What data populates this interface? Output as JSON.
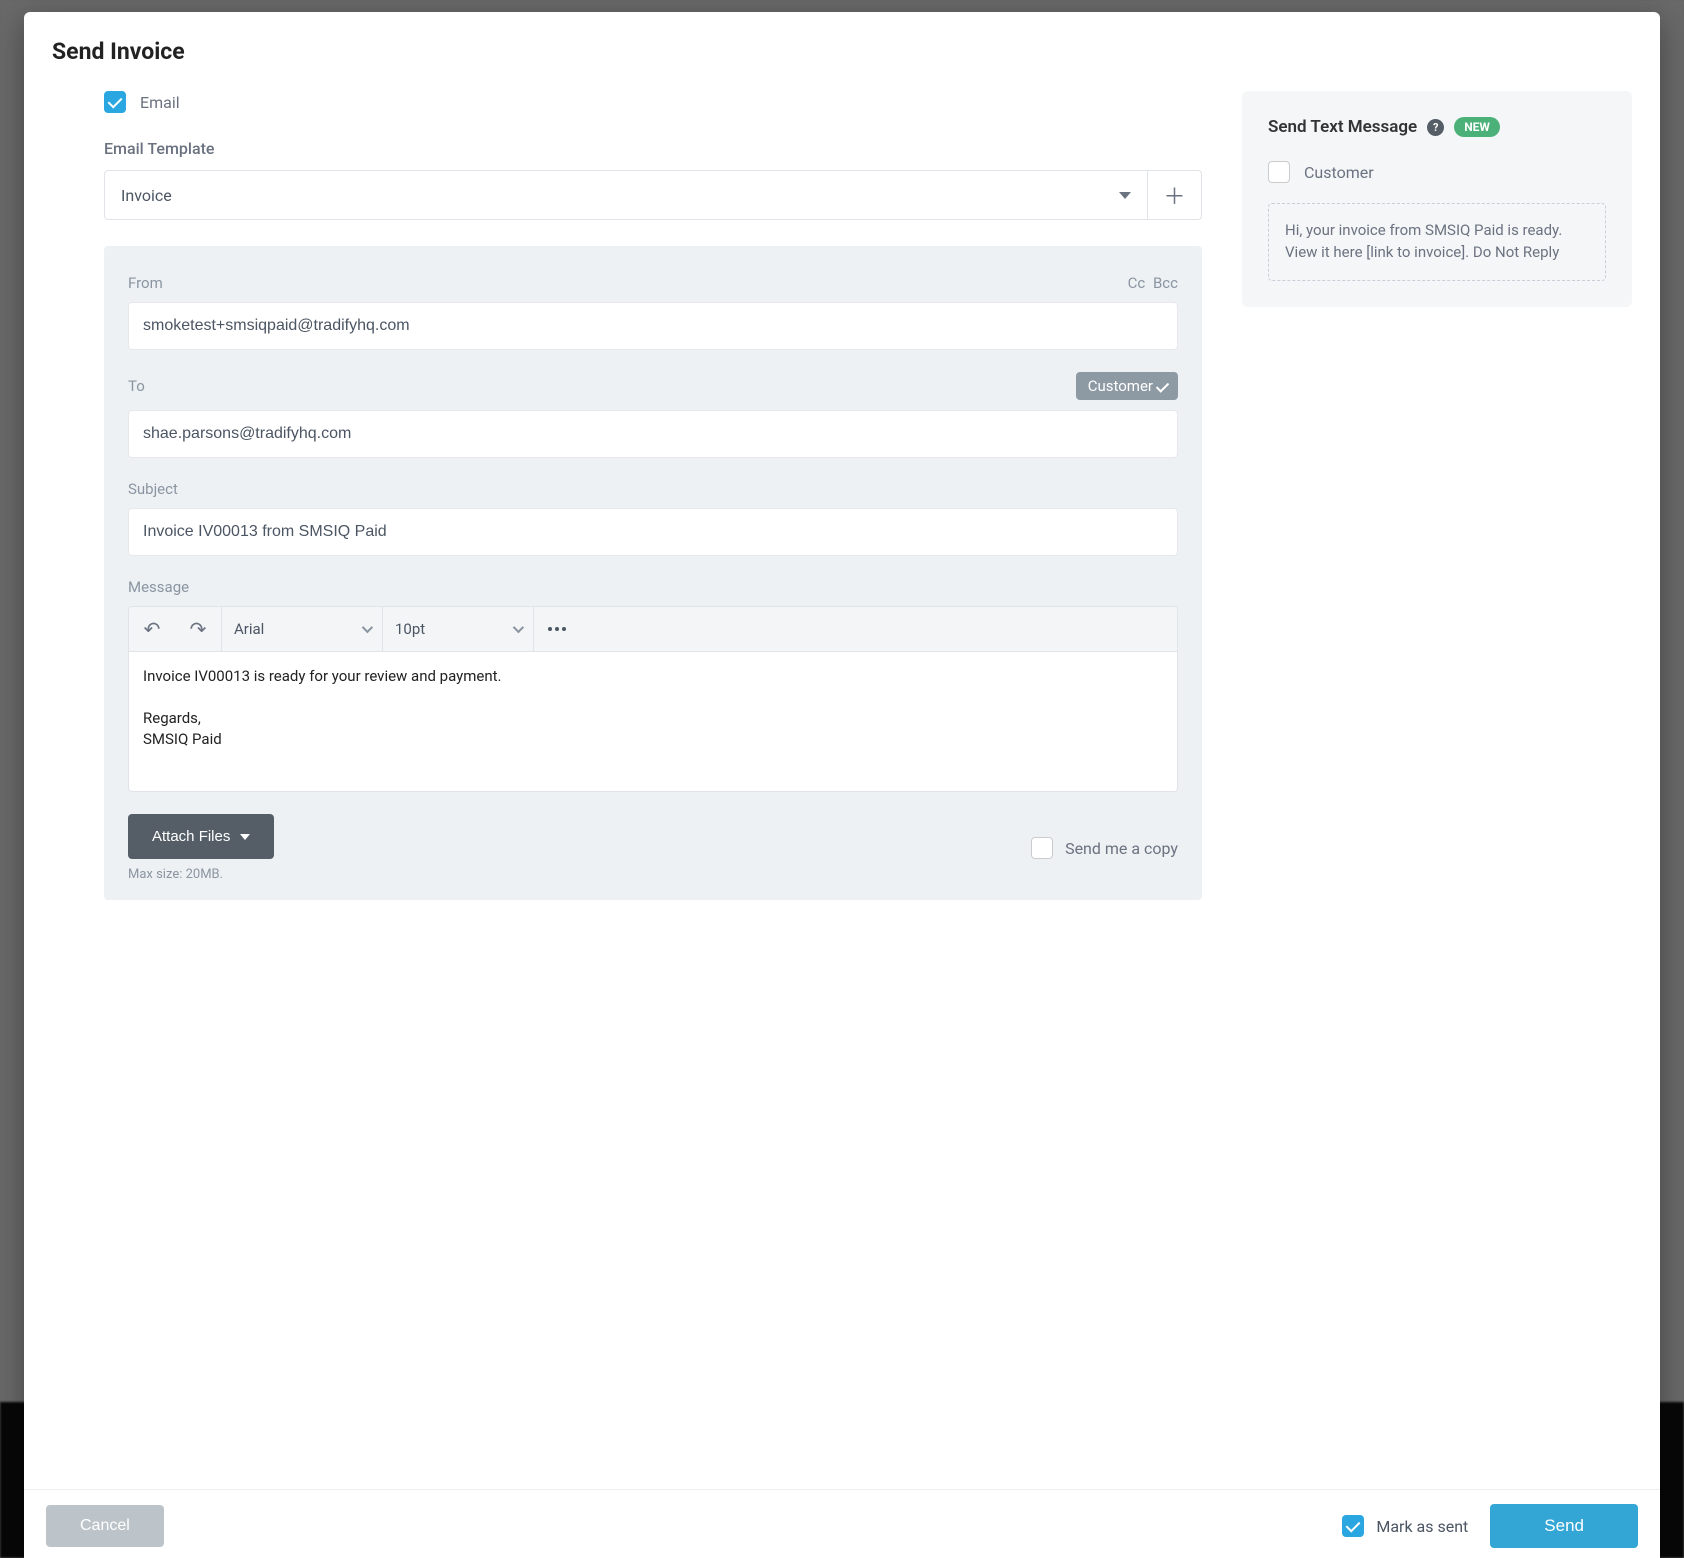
{
  "modal": {
    "title": "Send Invoice"
  },
  "email": {
    "checkbox_label": "Email",
    "checkbox_checked": true,
    "template_label": "Email Template",
    "template_value": "Invoice",
    "from_label": "From",
    "cc_label": "Cc",
    "bcc_label": "Bcc",
    "from_value": "smoketest+smsiqpaid@tradifyhq.com",
    "to_label": "To",
    "customer_badge": "Customer",
    "to_value": "shae.parsons@tradifyhq.com",
    "subject_label": "Subject",
    "subject_value": "Invoice IV00013 from SMSIQ Paid",
    "message_label": "Message",
    "toolbar": {
      "font": "Arial",
      "size": "10pt"
    },
    "message_body": "Invoice IV00013 is ready for your review and payment.\n\nRegards,\nSMSIQ Paid",
    "attach_label": "Attach Files",
    "send_copy_label": "Send me a copy",
    "max_size_hint": "Max size: 20MB."
  },
  "sms": {
    "title": "Send Text Message",
    "new_badge": "NEW",
    "customer_label": "Customer",
    "body": "Hi, your invoice from SMSIQ Paid is ready. View it here [link to invoice]. Do Not Reply"
  },
  "footer": {
    "cancel": "Cancel",
    "mark_as_sent": "Mark as sent",
    "send": "Send"
  }
}
